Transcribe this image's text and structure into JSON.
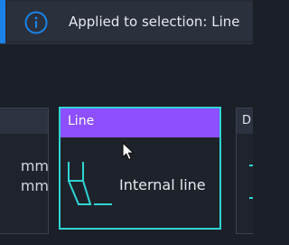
{
  "notification": {
    "icon": "info-icon",
    "text": "Applied to selection: Line",
    "accent_color": "#1a82e6"
  },
  "cards": {
    "left": {
      "lines": [
        "mm",
        "mm"
      ]
    },
    "line": {
      "title": "Line",
      "label": "Internal line",
      "icon": "tool-icon",
      "header_color": "#8d4fff",
      "border_color": "#2fd4d4"
    },
    "right": {
      "title": "D",
      "icon": "line-icon"
    }
  },
  "cursor": {
    "icon": "mouse-pointer-icon"
  }
}
